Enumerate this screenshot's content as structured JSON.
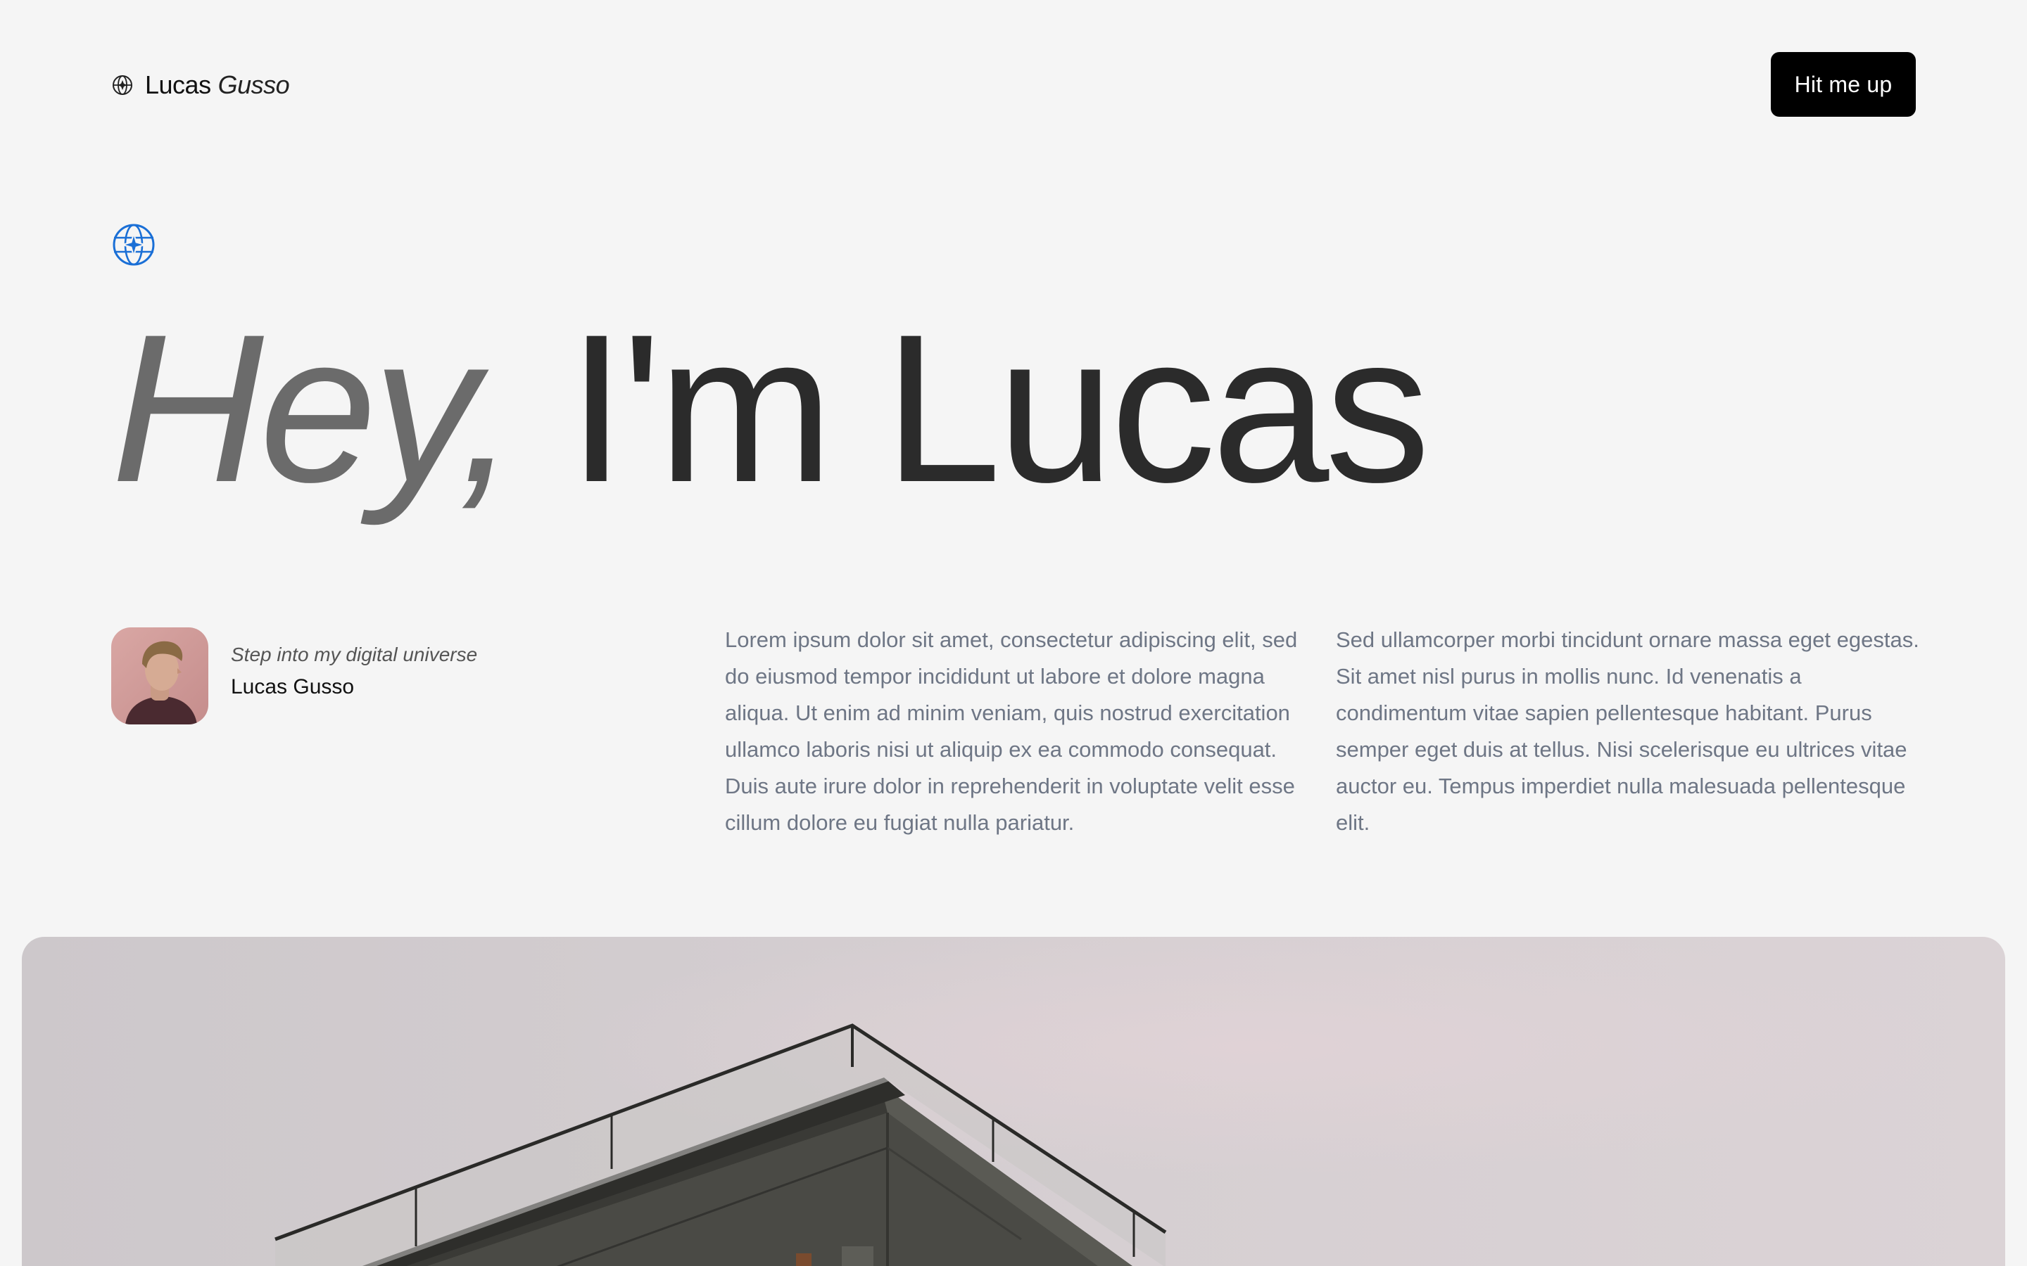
{
  "header": {
    "brand_first": "Lucas",
    "brand_last": "Gusso",
    "brand_icon": "globe-icon",
    "cta_label": "Hit me up"
  },
  "hero": {
    "badge_icon": "globe-sparkle-icon",
    "headline_greet": "Hey,",
    "headline_name": "I'm Lucas"
  },
  "profile": {
    "tagline": "Step into my digital universe",
    "name": "Lucas Gusso",
    "avatar": "portrait-avatar"
  },
  "intro": {
    "paragraph_1": "Lorem ipsum dolor sit amet, consectetur adipiscing elit, sed do eiusmod tempor incididunt ut labore et dolore magna aliqua. Ut enim ad minim veniam, quis nostrud exercitation ullamco laboris nisi ut aliquip ex ea commodo consequat. Duis aute irure dolor in reprehenderit in voluptate velit esse cillum dolore eu fugiat nulla pariatur.",
    "paragraph_2": "Sed ullamcorper morbi tincidunt ornare massa eget egestas. Sit amet nisl purus in mollis nunc. Id venenatis a condimentum vitae sapien pellentesque habitant. Purus semper eget duis at tellus. Nisi scelerisque eu ultrices vitae auctor eu. Tempus imperdiet nulla malesuada pellentesque elit."
  },
  "feature_image": {
    "subject": "building-rooftop-photo"
  },
  "colors": {
    "background": "#f5f5f5",
    "accent_blue": "#1a6fd6",
    "cta_bg": "#000000",
    "body_text": "#6e7685",
    "headline_dark": "#2b2b2b",
    "headline_light": "#6b6b6b"
  }
}
